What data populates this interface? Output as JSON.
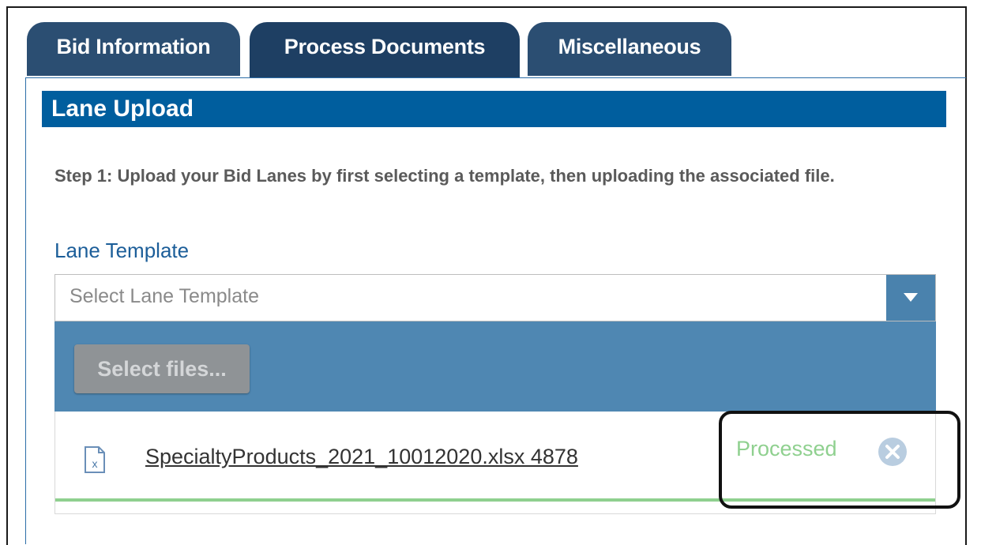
{
  "tabs": [
    {
      "label": "Bid Information",
      "active": false
    },
    {
      "label": "Process Documents",
      "active": true
    },
    {
      "label": "Miscellaneous",
      "active": false
    }
  ],
  "section": {
    "title": "Lane Upload"
  },
  "step_text": "Step 1: Upload your Bid Lanes by first selecting a template, then uploading the associated file.",
  "lane_template": {
    "label": "Lane Template",
    "placeholder": "Select Lane Template"
  },
  "upload": {
    "select_files_label": "Select files..."
  },
  "files": [
    {
      "name": "SpecialtyProducts_2021_10012020.xlsx 4878",
      "status": "Processed",
      "progress": 1.0
    }
  ],
  "colors": {
    "tab_bg": "#2b4e72",
    "header_bg": "#005e9e",
    "upload_bar_bg": "#4f87b2",
    "processed_green": "#8fd08f"
  },
  "icons": {
    "dropdown": "chevron-down-icon",
    "file": "excel-file-icon",
    "remove": "close-circle-icon"
  }
}
